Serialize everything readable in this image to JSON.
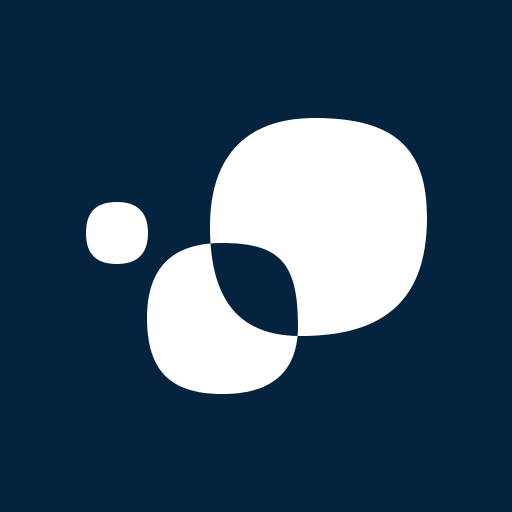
{
  "logo": {
    "name": "overlapping-blobs-logo",
    "colors": {
      "background": "#03233e",
      "foreground": "#ffffff"
    }
  }
}
